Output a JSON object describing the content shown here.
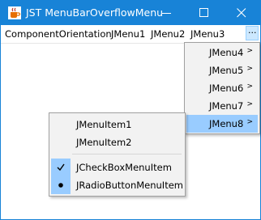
{
  "window": {
    "title": "JST MenuBarOverflowMenu",
    "app_icon": "java-cup-icon"
  },
  "title_buttons": {
    "minimize": "minimize-icon",
    "maximize": "maximize-icon",
    "close": "close-icon"
  },
  "menubar": {
    "menus": [
      "ComponentOrientation",
      "JMenu1",
      "JMenu2",
      "JMenu3"
    ],
    "overflow_label": "..."
  },
  "overflow_menu": {
    "items": [
      "JMenu4",
      "JMenu5",
      "JMenu6",
      "JMenu7",
      "JMenu8"
    ],
    "selected": "JMenu8",
    "submenu_arrow": ">"
  },
  "submenu": {
    "item1": "JMenuItem1",
    "item2": "JMenuItem2",
    "checkbox": {
      "label": "JCheckBoxMenuItem",
      "checked": true
    },
    "radio": {
      "label": "JRadioButtonMenuItem",
      "selected": true
    }
  },
  "colors": {
    "titlebar": "#1883d7",
    "selection": "#99ccff",
    "popup_bg": "#f2f2f2"
  }
}
